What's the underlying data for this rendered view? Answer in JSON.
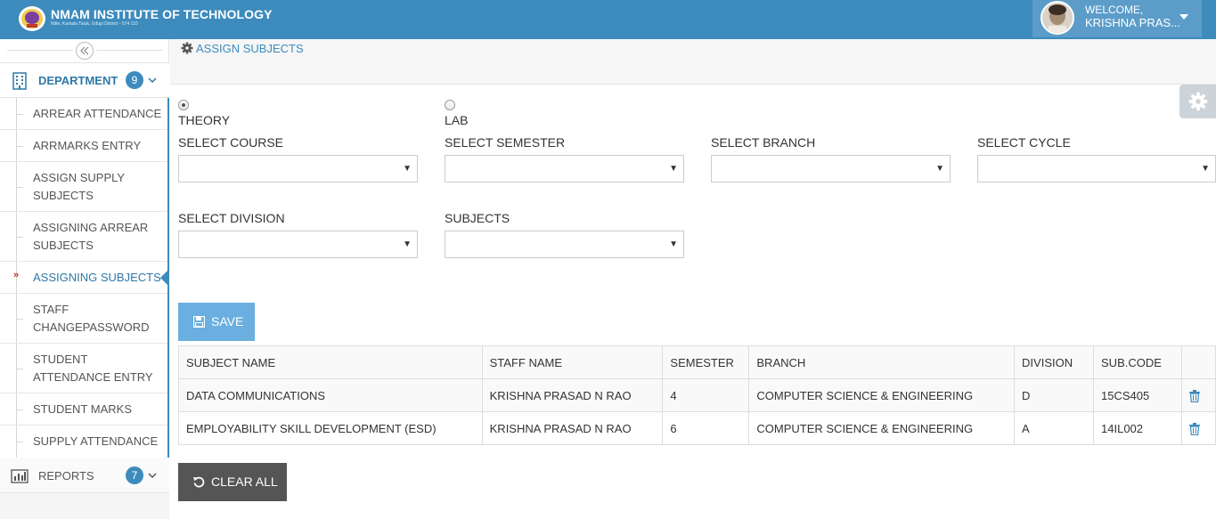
{
  "header": {
    "title": "NMAM INSTITUTE OF TECHNOLOGY",
    "subtitle": "Nitte, Karkala Taluk, Udupi District - 574 110",
    "welcome": "WELCOME,",
    "user_name": "KRISHNA PRAS..."
  },
  "sidebar": {
    "department": {
      "label": "DEPARTMENT",
      "count": "9"
    },
    "items": [
      {
        "label": "ARREAR ATTENDANCE"
      },
      {
        "label": "ARRMARKS ENTRY"
      },
      {
        "label": "ASSIGN SUPPLY SUBJECTS"
      },
      {
        "label": "ASSIGNING ARREAR SUBJECTS"
      },
      {
        "label": "ASSIGNING SUBJECTS"
      },
      {
        "label": "STAFF CHANGEPASSWORD"
      },
      {
        "label": "STUDENT ATTENDANCE ENTRY"
      },
      {
        "label": "STUDENT MARKS"
      },
      {
        "label": "SUPPLY ATTENDANCE"
      }
    ],
    "active_marker": "»",
    "reports": {
      "label": "REPORTS",
      "count": "7"
    }
  },
  "breadcrumb": {
    "label": "ASSIGN SUBJECTS"
  },
  "form": {
    "radio_theory": "THEORY",
    "radio_lab": "LAB",
    "selected_type": "THEORY",
    "course_label": "SELECT COURSE",
    "semester_label": "SELECT SEMESTER",
    "branch_label": "SELECT BRANCH",
    "cycle_label": "SELECT CYCLE",
    "division_label": "SELECT DIVISION",
    "subjects_label": "SUBJECTS",
    "course_value": "",
    "semester_value": "",
    "branch_value": "",
    "cycle_value": "",
    "division_value": "",
    "subjects_value": ""
  },
  "buttons": {
    "save": "SAVE",
    "clear_all": "CLEAR ALL"
  },
  "table": {
    "headers": [
      "SUBJECT NAME",
      "STAFF NAME",
      "SEMESTER",
      "BRANCH",
      "DIVISION",
      "SUB.CODE",
      ""
    ],
    "rows": [
      [
        "DATA COMMUNICATIONS",
        "KRISHNA PRASAD N RAO",
        "4",
        "COMPUTER SCIENCE & ENGINEERING",
        "D",
        "15CS405"
      ],
      [
        "EMPLOYABILITY SKILL DEVELOPMENT (ESD)",
        "KRISHNA PRASAD N RAO",
        "6",
        "COMPUTER SCIENCE & ENGINEERING",
        "A",
        "14IL002"
      ]
    ]
  },
  "colors": {
    "primary": "#3d8bbd",
    "save_button": "#6aafdf",
    "clear_button": "#555555",
    "delete_icon": "#3d8bbd"
  }
}
